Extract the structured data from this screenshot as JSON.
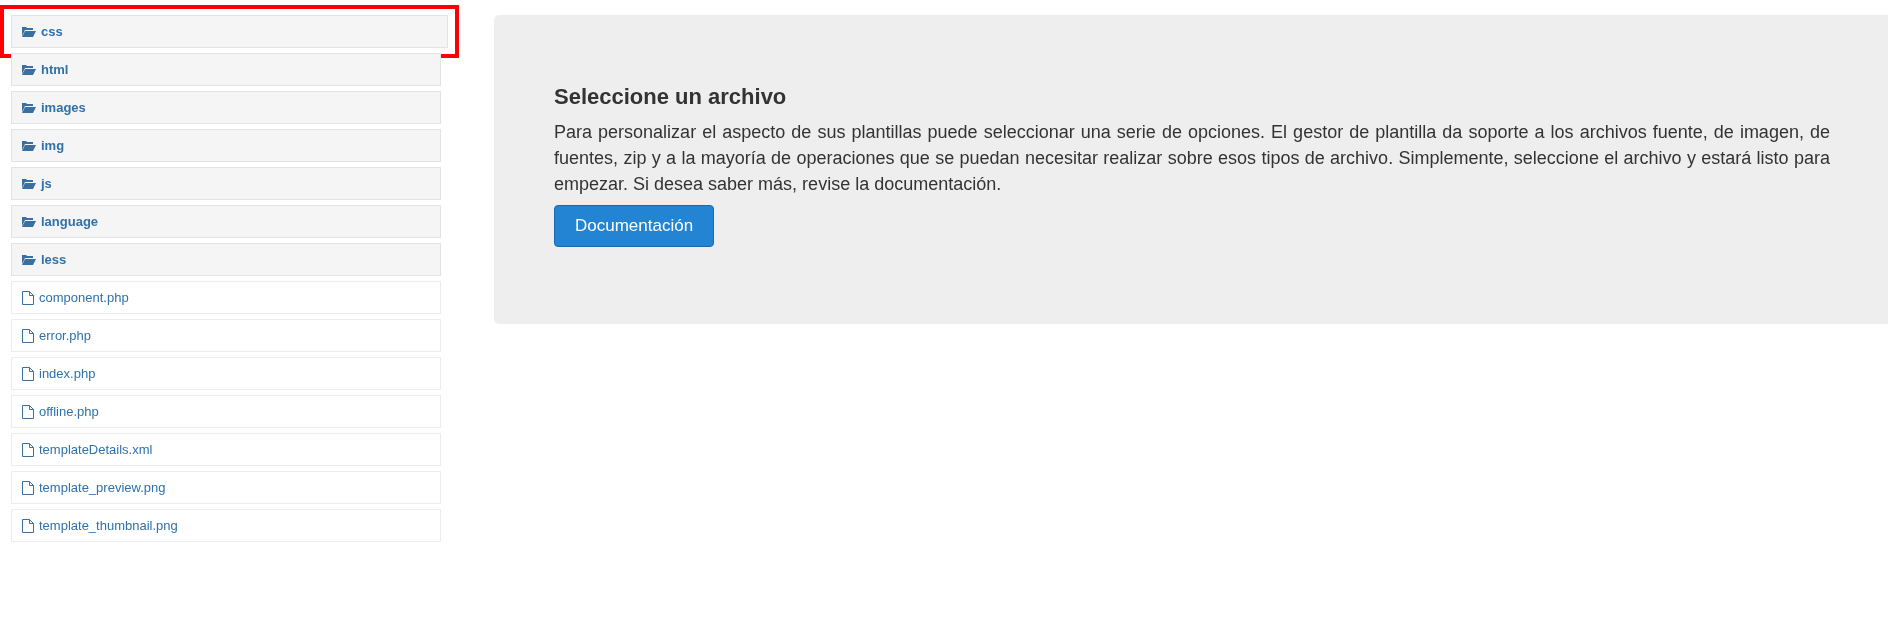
{
  "file_tree": [
    {
      "kind": "folder",
      "name": "css",
      "highlighted": true
    },
    {
      "kind": "folder",
      "name": "html",
      "highlighted": false
    },
    {
      "kind": "folder",
      "name": "images",
      "highlighted": false
    },
    {
      "kind": "folder",
      "name": "img",
      "highlighted": false
    },
    {
      "kind": "folder",
      "name": "js",
      "highlighted": false
    },
    {
      "kind": "folder",
      "name": "language",
      "highlighted": false
    },
    {
      "kind": "folder",
      "name": "less",
      "highlighted": false
    },
    {
      "kind": "file",
      "name": "component.php",
      "highlighted": false
    },
    {
      "kind": "file",
      "name": "error.php",
      "highlighted": false
    },
    {
      "kind": "file",
      "name": "index.php",
      "highlighted": false
    },
    {
      "kind": "file",
      "name": "offline.php",
      "highlighted": false
    },
    {
      "kind": "file",
      "name": "templateDetails.xml",
      "highlighted": false
    },
    {
      "kind": "file",
      "name": "template_preview.png",
      "highlighted": false
    },
    {
      "kind": "file",
      "name": "template_thumbnail.png",
      "highlighted": false
    }
  ],
  "panel": {
    "title": "Seleccione un archivo",
    "text": "Para personalizar el aspecto de sus plantillas puede seleccionar una serie de opciones. El gestor de plantilla da soporte a los archivos fuente, de imagen, de fuentes, zip y a la mayoría de operaciones que se puedan necesitar realizar sobre esos tipos de archivo. Simplemente, seleccione el archivo y estará listo para empezar. Si desea saber más, revise la documentación.",
    "button": "Documentación"
  }
}
